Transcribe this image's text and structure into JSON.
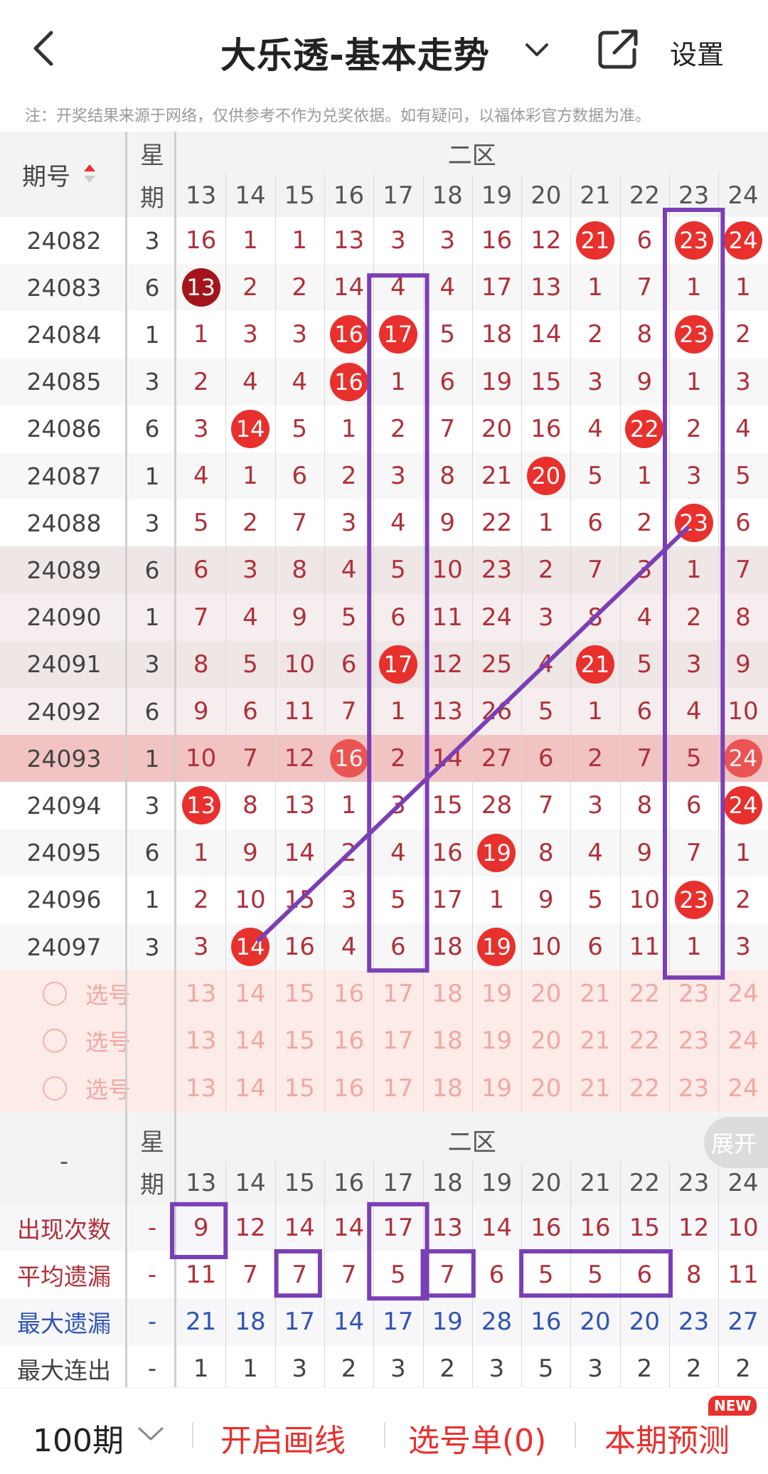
{
  "header": {
    "title": "大乐透-基本走势",
    "settings_label": "设置",
    "notice": "注：开奖结果来源于网络，仅供参考不作为兑奖依据。如有疑问，以福体彩官方数据为准。"
  },
  "table": {
    "period_header": "期号",
    "week_header_top": "星",
    "week_header_bottom": "期",
    "zone_label": "二区",
    "columns": [
      "13",
      "14",
      "15",
      "16",
      "17",
      "18",
      "19",
      "20",
      "21",
      "22",
      "23",
      "24"
    ],
    "rows": [
      {
        "period": "24082",
        "week": "3",
        "cells": [
          "16",
          "1",
          "1",
          "13",
          "3",
          "3",
          "16",
          "12",
          "21",
          "6",
          "23",
          "24"
        ],
        "hits": [
          8,
          10,
          11
        ]
      },
      {
        "period": "24083",
        "week": "6",
        "cells": [
          "13",
          "2",
          "2",
          "14",
          "4",
          "4",
          "17",
          "13",
          "1",
          "7",
          "1",
          "1"
        ],
        "hits": [
          0
        ],
        "dark": [
          0
        ]
      },
      {
        "period": "24084",
        "week": "1",
        "cells": [
          "1",
          "3",
          "3",
          "16",
          "17",
          "5",
          "18",
          "14",
          "2",
          "8",
          "23",
          "2"
        ],
        "hits": [
          3,
          4,
          10
        ]
      },
      {
        "period": "24085",
        "week": "3",
        "cells": [
          "2",
          "4",
          "4",
          "16",
          "1",
          "6",
          "19",
          "15",
          "3",
          "9",
          "1",
          "3"
        ],
        "hits": [
          3
        ]
      },
      {
        "period": "24086",
        "week": "6",
        "cells": [
          "3",
          "14",
          "5",
          "1",
          "2",
          "7",
          "20",
          "16",
          "4",
          "22",
          "2",
          "4"
        ],
        "hits": [
          1,
          9
        ]
      },
      {
        "period": "24087",
        "week": "1",
        "cells": [
          "4",
          "1",
          "6",
          "2",
          "3",
          "8",
          "21",
          "20",
          "5",
          "1",
          "3",
          "5"
        ],
        "hits": [
          7
        ]
      },
      {
        "period": "24088",
        "week": "3",
        "cells": [
          "5",
          "2",
          "7",
          "3",
          "4",
          "9",
          "22",
          "1",
          "6",
          "2",
          "23",
          "6"
        ],
        "hits": [
          10
        ]
      },
      {
        "period": "24089",
        "week": "6",
        "cells": [
          "6",
          "3",
          "8",
          "4",
          "5",
          "10",
          "23",
          "2",
          "7",
          "3",
          "1",
          "7"
        ],
        "hits": []
      },
      {
        "period": "24090",
        "week": "1",
        "cells": [
          "7",
          "4",
          "9",
          "5",
          "6",
          "11",
          "24",
          "3",
          "8",
          "4",
          "2",
          "8"
        ],
        "hits": []
      },
      {
        "period": "24091",
        "week": "3",
        "cells": [
          "8",
          "5",
          "10",
          "6",
          "17",
          "12",
          "25",
          "4",
          "21",
          "5",
          "3",
          "9"
        ],
        "hits": [
          4,
          8
        ]
      },
      {
        "period": "24092",
        "week": "6",
        "cells": [
          "9",
          "6",
          "11",
          "7",
          "1",
          "13",
          "26",
          "5",
          "1",
          "6",
          "4",
          "10"
        ],
        "hits": []
      },
      {
        "period": "24093",
        "week": "1",
        "cells": [
          "10",
          "7",
          "12",
          "16",
          "2",
          "14",
          "27",
          "6",
          "2",
          "7",
          "5",
          "24"
        ],
        "hits": [
          3,
          11
        ],
        "highlight": true
      },
      {
        "period": "24094",
        "week": "3",
        "cells": [
          "13",
          "8",
          "13",
          "1",
          "3",
          "15",
          "28",
          "7",
          "3",
          "8",
          "6",
          "24"
        ],
        "hits": [
          0,
          11
        ]
      },
      {
        "period": "24095",
        "week": "6",
        "cells": [
          "1",
          "9",
          "14",
          "2",
          "4",
          "16",
          "19",
          "8",
          "4",
          "9",
          "7",
          "1"
        ],
        "hits": [
          6
        ]
      },
      {
        "period": "24096",
        "week": "1",
        "cells": [
          "2",
          "10",
          "15",
          "3",
          "5",
          "17",
          "1",
          "9",
          "5",
          "10",
          "23",
          "2"
        ],
        "hits": [
          10
        ]
      },
      {
        "period": "24097",
        "week": "3",
        "cells": [
          "3",
          "14",
          "16",
          "4",
          "6",
          "18",
          "19",
          "10",
          "6",
          "11",
          "1",
          "3"
        ],
        "hits": [
          1,
          6
        ]
      }
    ],
    "pick_rows": [
      {
        "label": "选号"
      },
      {
        "label": "选号"
      },
      {
        "label": "选号"
      }
    ]
  },
  "stats": {
    "dash": "-",
    "week_header_top": "星",
    "week_header_bottom": "期",
    "zone_label": "二区",
    "expand_label": "展开",
    "rows": [
      {
        "label": "出现次数",
        "color": "#b0303a",
        "week": "-",
        "values": [
          "9",
          "12",
          "14",
          "14",
          "17",
          "13",
          "14",
          "16",
          "16",
          "15",
          "12",
          "10"
        ]
      },
      {
        "label": "平均遗漏",
        "color": "#b0303a",
        "week": "-",
        "values": [
          "11",
          "7",
          "7",
          "7",
          "5",
          "7",
          "6",
          "5",
          "5",
          "6",
          "8",
          "11"
        ]
      },
      {
        "label": "最大遗漏",
        "color": "#2f55b5",
        "week": "-",
        "values": [
          "21",
          "18",
          "17",
          "14",
          "17",
          "19",
          "28",
          "16",
          "20",
          "20",
          "23",
          "27"
        ]
      },
      {
        "label": "最大连出",
        "color": "#444",
        "week": "-",
        "values": [
          "1",
          "1",
          "3",
          "2",
          "3",
          "2",
          "3",
          "5",
          "3",
          "2",
          "2",
          "2"
        ]
      }
    ]
  },
  "bottom": {
    "period_select": "100期",
    "draw_line": "开启画线",
    "selection_list": "选号单(0)",
    "prediction": "本期预测",
    "new_badge": "NEW"
  },
  "colors": {
    "accent": "#e8302d",
    "dark_ball": "#a3151a",
    "annotation": "#7b3fb5",
    "pick_bg": "#fdebe8",
    "highlight_row": "#f2c3c3"
  }
}
